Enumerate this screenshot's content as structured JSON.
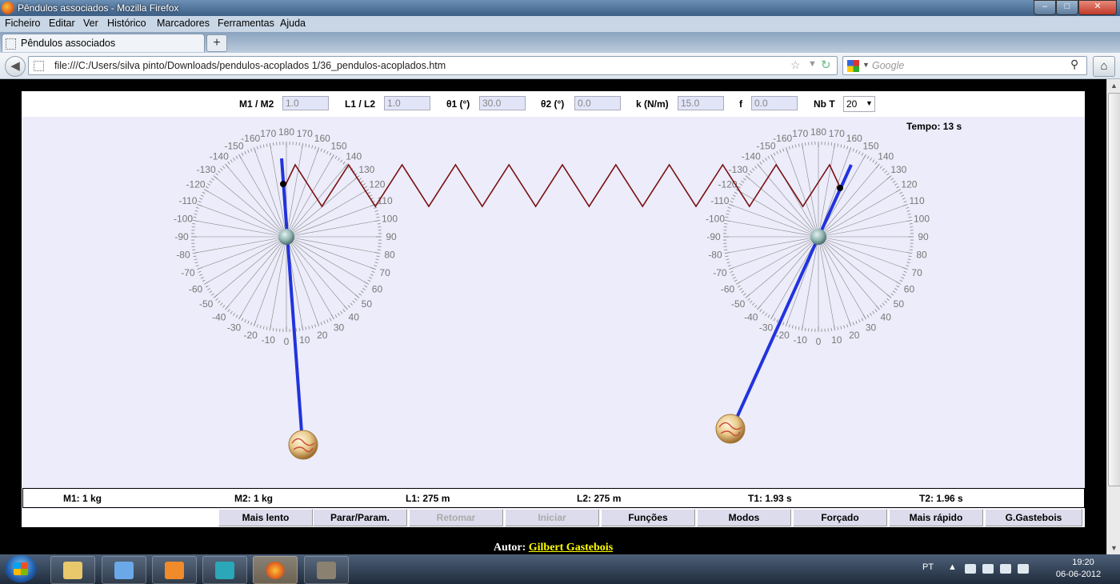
{
  "window": {
    "title": "Pêndulos associados - Mozilla Firefox"
  },
  "menu": [
    "Ficheiro",
    "Editar",
    "Ver",
    "Histórico",
    "Marcadores",
    "Ferramentas",
    "Ajuda"
  ],
  "tab": {
    "title": "Pêndulos associados",
    "new_tab": "+"
  },
  "nav": {
    "url": "file:///C:/Users/silva pinto/Downloads/pendulos-acoplados 1/36_pendulos-acoplados.htm",
    "search_placeholder": "Google"
  },
  "params": {
    "m1m2_label": "M1 / M2",
    "m1m2_value": "1.0",
    "l1l2_label": "L1 / L2",
    "l1l2_value": "1.0",
    "theta1_label": "θ1 (°)",
    "theta1_value": "30.0",
    "theta2_label": "θ2 (°)",
    "theta2_value": "0.0",
    "k_label": "k (N/m)",
    "k_value": "15.0",
    "f_label": "f",
    "f_value": "0.0",
    "nbt_label": "Nb T",
    "nbt_value": "20"
  },
  "tempo": "Tempo: 13 s",
  "dial_labels": {
    "right_side": [
      "0",
      "10",
      "20",
      "30",
      "40",
      "50",
      "60",
      "70",
      "80",
      "90",
      "100",
      "110",
      "120",
      "130",
      "140",
      "150",
      "160",
      "170",
      "180"
    ],
    "left_side": [
      "-10",
      "-20",
      "-30",
      "-40",
      "-50",
      "-60",
      "-70",
      "-80",
      "-90",
      "-100",
      "-110",
      "-120",
      "-130",
      "-140",
      "-150",
      "-160",
      "170"
    ]
  },
  "stats": {
    "m1": "M1: 1 kg",
    "m2": "M2: 1 kg",
    "l1": "L1: 275 m",
    "l2": "L2: 275 m",
    "t1": "T1: 1.93 s",
    "t2": "T2: 1.96 s"
  },
  "buttons": {
    "slower": "Mais lento",
    "stop": "Parar/Param.",
    "resume": "Retomar",
    "start": "Iniciar",
    "functions": "Funções",
    "modes": "Modos",
    "forced": "Forçado",
    "faster": "Mais rápido",
    "author_btn": "G.Gastebois"
  },
  "author": {
    "label": "Autor:",
    "name": "Gilbert Gastebois"
  },
  "tray": {
    "lang": "PT",
    "time": "19:20",
    "date": "06-06-2012"
  },
  "colors": {
    "rod": "#2233dd",
    "spring": "#7a1010",
    "panel": "#ececfa"
  }
}
